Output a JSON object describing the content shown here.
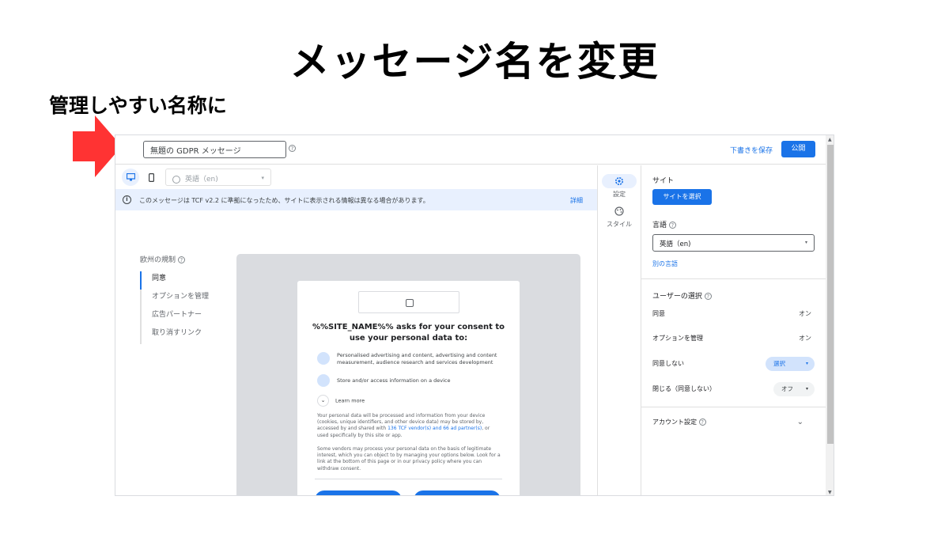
{
  "slide": {
    "title": "メッセージ名を変更",
    "caption": "管理しやすい名称に"
  },
  "colors": {
    "accent": "#1a73e8",
    "arrow": "#ff3333",
    "info_bg": "#e8f0fe"
  },
  "header": {
    "message_name_value": "無題の GDPR メッセージ",
    "help_glyph": "?",
    "save_draft_label": "下書きを保存",
    "publish_label": "公開"
  },
  "toolbar": {
    "language_value": "英語（en)",
    "caret_glyph": "▾"
  },
  "infobar": {
    "icon_glyph": "i",
    "text": "このメッセージは TCF v2.2 に準拠になったため、サイトに表示される情報は異なる場合があります。",
    "detail_link": "詳細"
  },
  "rules": {
    "title": "欧州の規制",
    "items": [
      "同意",
      "オプションを管理",
      "広告パートナー",
      "取り消すリンク"
    ]
  },
  "dialog": {
    "title": "%%SITE_NAME%% asks for your consent to use your personal data to:",
    "purposes": [
      "Personalised advertising and content, advertising and content measurement, audience research and services development",
      "Store and/or access information on a device"
    ],
    "learn_more": "Learn more",
    "chevron_glyph": "⌄",
    "body1_before": "Your personal data will be processed and information from your device (cookies, unique identifiers, and other device data) may be stored by, accessed by and shared with",
    "body1_link": "136 TCF vendor(s) and 66 ad partner(s)",
    "body1_after": ", or used specifically by this site or app.",
    "body2": "Some vendors may process your personal data on the basis of legitimate interest, which you can object to by managing your options below. Look for a link at the bottom of this page or in our privacy policy where you can withdraw consent."
  },
  "rail": {
    "settings_label": "設定",
    "style_label": "スタイル"
  },
  "panel": {
    "site_label": "サイト",
    "select_site_button": "サイトを選択",
    "language_label": "言語",
    "language_value": "英語（en)",
    "other_language_link": "別の言語",
    "user_choice_label": "ユーザーの選択",
    "rows": [
      {
        "label": "同意",
        "value": "オン"
      },
      {
        "label": "オプションを管理",
        "value": "オン"
      },
      {
        "label": "同意しない",
        "value": "選択"
      },
      {
        "label": "閉じる（同意しない）",
        "value": "オフ"
      }
    ],
    "account_settings_label": "アカウント設定"
  }
}
